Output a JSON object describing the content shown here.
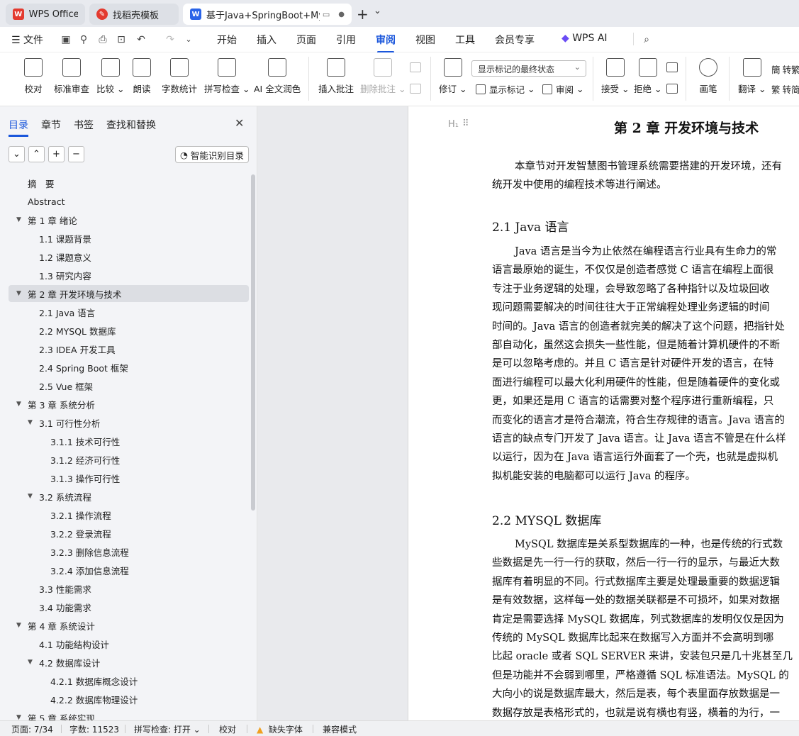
{
  "titlebar": {
    "tabs": [
      {
        "label": "WPS Office",
        "icon": "wps-logo-icon"
      },
      {
        "label": "找稻壳模板",
        "icon": "docer-icon"
      },
      {
        "label": "基于Java+SpringBoot+MyS",
        "icon": "word-doc-icon"
      }
    ],
    "new_tab": "+",
    "dropdown": "⌄"
  },
  "menubar": {
    "file_label": "文件",
    "items": [
      "开始",
      "插入",
      "页面",
      "引用",
      "审阅",
      "视图",
      "工具",
      "会员专享"
    ],
    "active": "审阅",
    "wps_ai": "WPS AI"
  },
  "ribbon": {
    "buttons": [
      {
        "label": "校对",
        "icon": "proofread-icon"
      },
      {
        "label": "标准审查",
        "icon": "standard-review-icon"
      },
      {
        "label": "比较",
        "icon": "compare-icon"
      },
      {
        "label": "朗读",
        "icon": "read-aloud-icon"
      },
      {
        "label": "字数统计",
        "icon": "word-count-icon"
      },
      {
        "label": "拼写检查",
        "icon": "spell-check-icon"
      },
      {
        "label": "AI 全文润色",
        "icon": "ai-polish-icon"
      },
      {
        "label": "插入批注",
        "icon": "insert-comment-icon"
      },
      {
        "label": "删除批注",
        "icon": "delete-comment-icon"
      },
      {
        "label": "修订",
        "icon": "track-changes-icon"
      },
      {
        "label": "接受",
        "icon": "accept-icon"
      },
      {
        "label": "拒绝",
        "icon": "reject-icon"
      },
      {
        "label": "画笔",
        "icon": "pen-icon"
      },
      {
        "label": "翻译",
        "icon": "translate-icon"
      }
    ],
    "markup_select": "显示标记的最终状态",
    "show_markup": "显示标记",
    "review_pane": "审阅",
    "to_traditional": "转繁",
    "to_simplified": "转简"
  },
  "pane": {
    "tabs": [
      "目录",
      "章节",
      "书签",
      "查找和替换"
    ],
    "smart_button": "智能识别目录",
    "toc": [
      {
        "label": "摘　要",
        "level": 1
      },
      {
        "label": "Abstract",
        "level": 1
      },
      {
        "label": "第 1 章  绪论",
        "level": 1,
        "expanded": true
      },
      {
        "label": "1.1  课题背景",
        "level": 2
      },
      {
        "label": "1.2  课题意义",
        "level": 2
      },
      {
        "label": "1.3  研究内容",
        "level": 2
      },
      {
        "label": "第 2 章  开发环境与技术",
        "level": 1,
        "expanded": true,
        "selected": true
      },
      {
        "label": "2.1 Java 语言",
        "level": 2
      },
      {
        "label": "2.2 MYSQL 数据库",
        "level": 2
      },
      {
        "label": "2.3 IDEA 开发工具",
        "level": 2
      },
      {
        "label": "2.4 Spring Boot 框架",
        "level": 2
      },
      {
        "label": "2.5 Vue 框架",
        "level": 2
      },
      {
        "label": "第 3 章  系统分析",
        "level": 1,
        "expanded": true
      },
      {
        "label": "3.1  可行性分析",
        "level": 2,
        "expanded": true
      },
      {
        "label": "3.1.1  技术可行性",
        "level": 3
      },
      {
        "label": "3.1.2  经济可行性",
        "level": 3
      },
      {
        "label": "3.1.3  操作可行性",
        "level": 3
      },
      {
        "label": "3.2  系统流程",
        "level": 2,
        "expanded": true
      },
      {
        "label": "3.2.1  操作流程",
        "level": 3
      },
      {
        "label": "3.2.2  登录流程",
        "level": 3
      },
      {
        "label": "3.2.3  删除信息流程",
        "level": 3
      },
      {
        "label": "3.2.4  添加信息流程",
        "level": 3
      },
      {
        "label": "3.3  性能需求",
        "level": 2
      },
      {
        "label": "3.4  功能需求",
        "level": 2
      },
      {
        "label": "第 4 章  系统设计",
        "level": 1,
        "expanded": true
      },
      {
        "label": "4.1  功能结构设计",
        "level": 2
      },
      {
        "label": "4.2  数据库设计",
        "level": 2,
        "expanded": true
      },
      {
        "label": "4.2.1  数据库概念设计",
        "level": 3
      },
      {
        "label": "4.2.2  数据库物理设计",
        "level": 3
      },
      {
        "label": "第 5 章  系统实现",
        "level": 1,
        "expanded": true
      }
    ]
  },
  "document": {
    "heading_marker": "H₁",
    "chapter_title": "第 2 章  开发环境与技术",
    "intro": [
      "本章节对开发智慧图书管理系统需要搭建的开发环境，还有",
      "统开发中使用的编程技术等进行阐述。"
    ],
    "s21_title": "2.1 Java 语言",
    "s21": [
      "Java 语言是当今为止依然在编程语言行业具有生命力的常",
      "语言最原始的诞生，不仅仅是创造者感觉 C 语言在编程上面很",
      "专注于业务逻辑的处理，会导致忽略了各种指针以及垃圾回收",
      "现问题需要解决的时间往往大于正常编程处理业务逻辑的时间",
      "时间的。Java 语言的创造者就完美的解决了这个问题，把指针处",
      "部自动化，虽然这会损失一些性能，但是随着计算机硬件的不断",
      "是可以忽略考虑的。并且 C 语言是针对硬件开发的语言，在特",
      "面进行编程可以最大化利用硬件的性能，但是随着硬件的变化或",
      "更，如果还是用 C 语言的话需要对整个程序进行重新编程，只",
      "而变化的语言才是符合潮流，符合生存规律的语言。Java 语言的",
      "语言的缺点专门开发了 Java 语言。让 Java 语言不管是在什么样",
      "以运行，因为在 Java 语言运行外面套了一个壳，也就是虚拟机",
      "拟机能安装的电脑都可以运行 Java 的程序。"
    ],
    "s22_title": "2.2 MYSQL 数据库",
    "s22": [
      "MySQL 数据库是关系型数据库的一种，也是传统的行式数",
      "些数据是先一行一行的获取，然后一行一行的显示，与最近大数",
      "据库有着明显的不同。行式数据库主要是处理最重要的数据逻辑",
      "是有效数据，这样每一处的数据关联都是不可损坏，如果对数据",
      "肯定是需要选择 MySQL 数据库，列式数据库的发明仅仅是因为",
      "传统的 MySQL 数据库比起来在数据写入方面并不会高明到哪",
      "比起 oracle 或者 SQL SERVER 来讲，安装包只是几十兆甚至几",
      "但是功能并不会弱到哪里，严格遵循 SQL 标准语法。MySQL 的",
      "大向小的说是数据库最大，然后是表，每个表里面存放数据是一",
      "数据存放是表格形式的，也就是说有横也有竖，横着的为行，一"
    ]
  },
  "statusbar": {
    "page": "页面: 7/34",
    "words": "字数: 11523",
    "spell": "拼写检查: 打开",
    "proofread": "校对",
    "missing_font": "缺失字体",
    "compat": "兼容模式"
  },
  "colors": {
    "accent": "#1a56db",
    "wps_red": "#e33a2f",
    "warn": "#f0a020"
  }
}
